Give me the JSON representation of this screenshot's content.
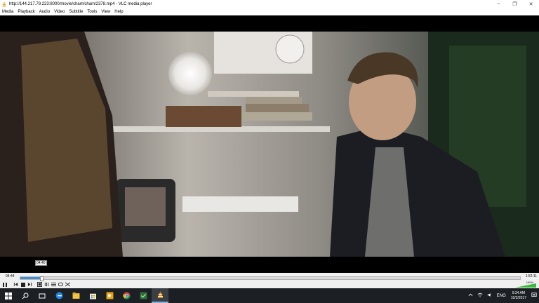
{
  "window": {
    "title": "http://144.217.79.223:8000/movie/cham/cham/2378.mp4 - VLC media player",
    "icon": "vlc-cone-icon",
    "controls": {
      "minimize": "–",
      "restore": "❐",
      "close": "✕"
    }
  },
  "menu": {
    "items": [
      "Media",
      "Playback",
      "Audio",
      "Video",
      "Subtitle",
      "Tools",
      "View",
      "Help"
    ]
  },
  "video": {
    "hover_time": "04:40"
  },
  "player": {
    "elapsed": "04:44",
    "total": "1:52:11",
    "progress_fraction": 0.042,
    "volume_label": "100%",
    "volume_fraction": 1.0
  },
  "taskbar": {
    "apps": [
      "start-icon",
      "search-icon",
      "task-view-icon",
      "edge-icon",
      "file-explorer-icon",
      "store-icon",
      "outlook-icon",
      "chrome-icon",
      "vpn-icon",
      "vlc-icon"
    ],
    "tray": {
      "language": "ENG",
      "time": "9:34 AM",
      "date": "10/2/2017"
    }
  },
  "colors": {
    "accent": "#3c8fd8",
    "taskbar": "#1c2024",
    "vlc_orange": "#f28c00"
  }
}
